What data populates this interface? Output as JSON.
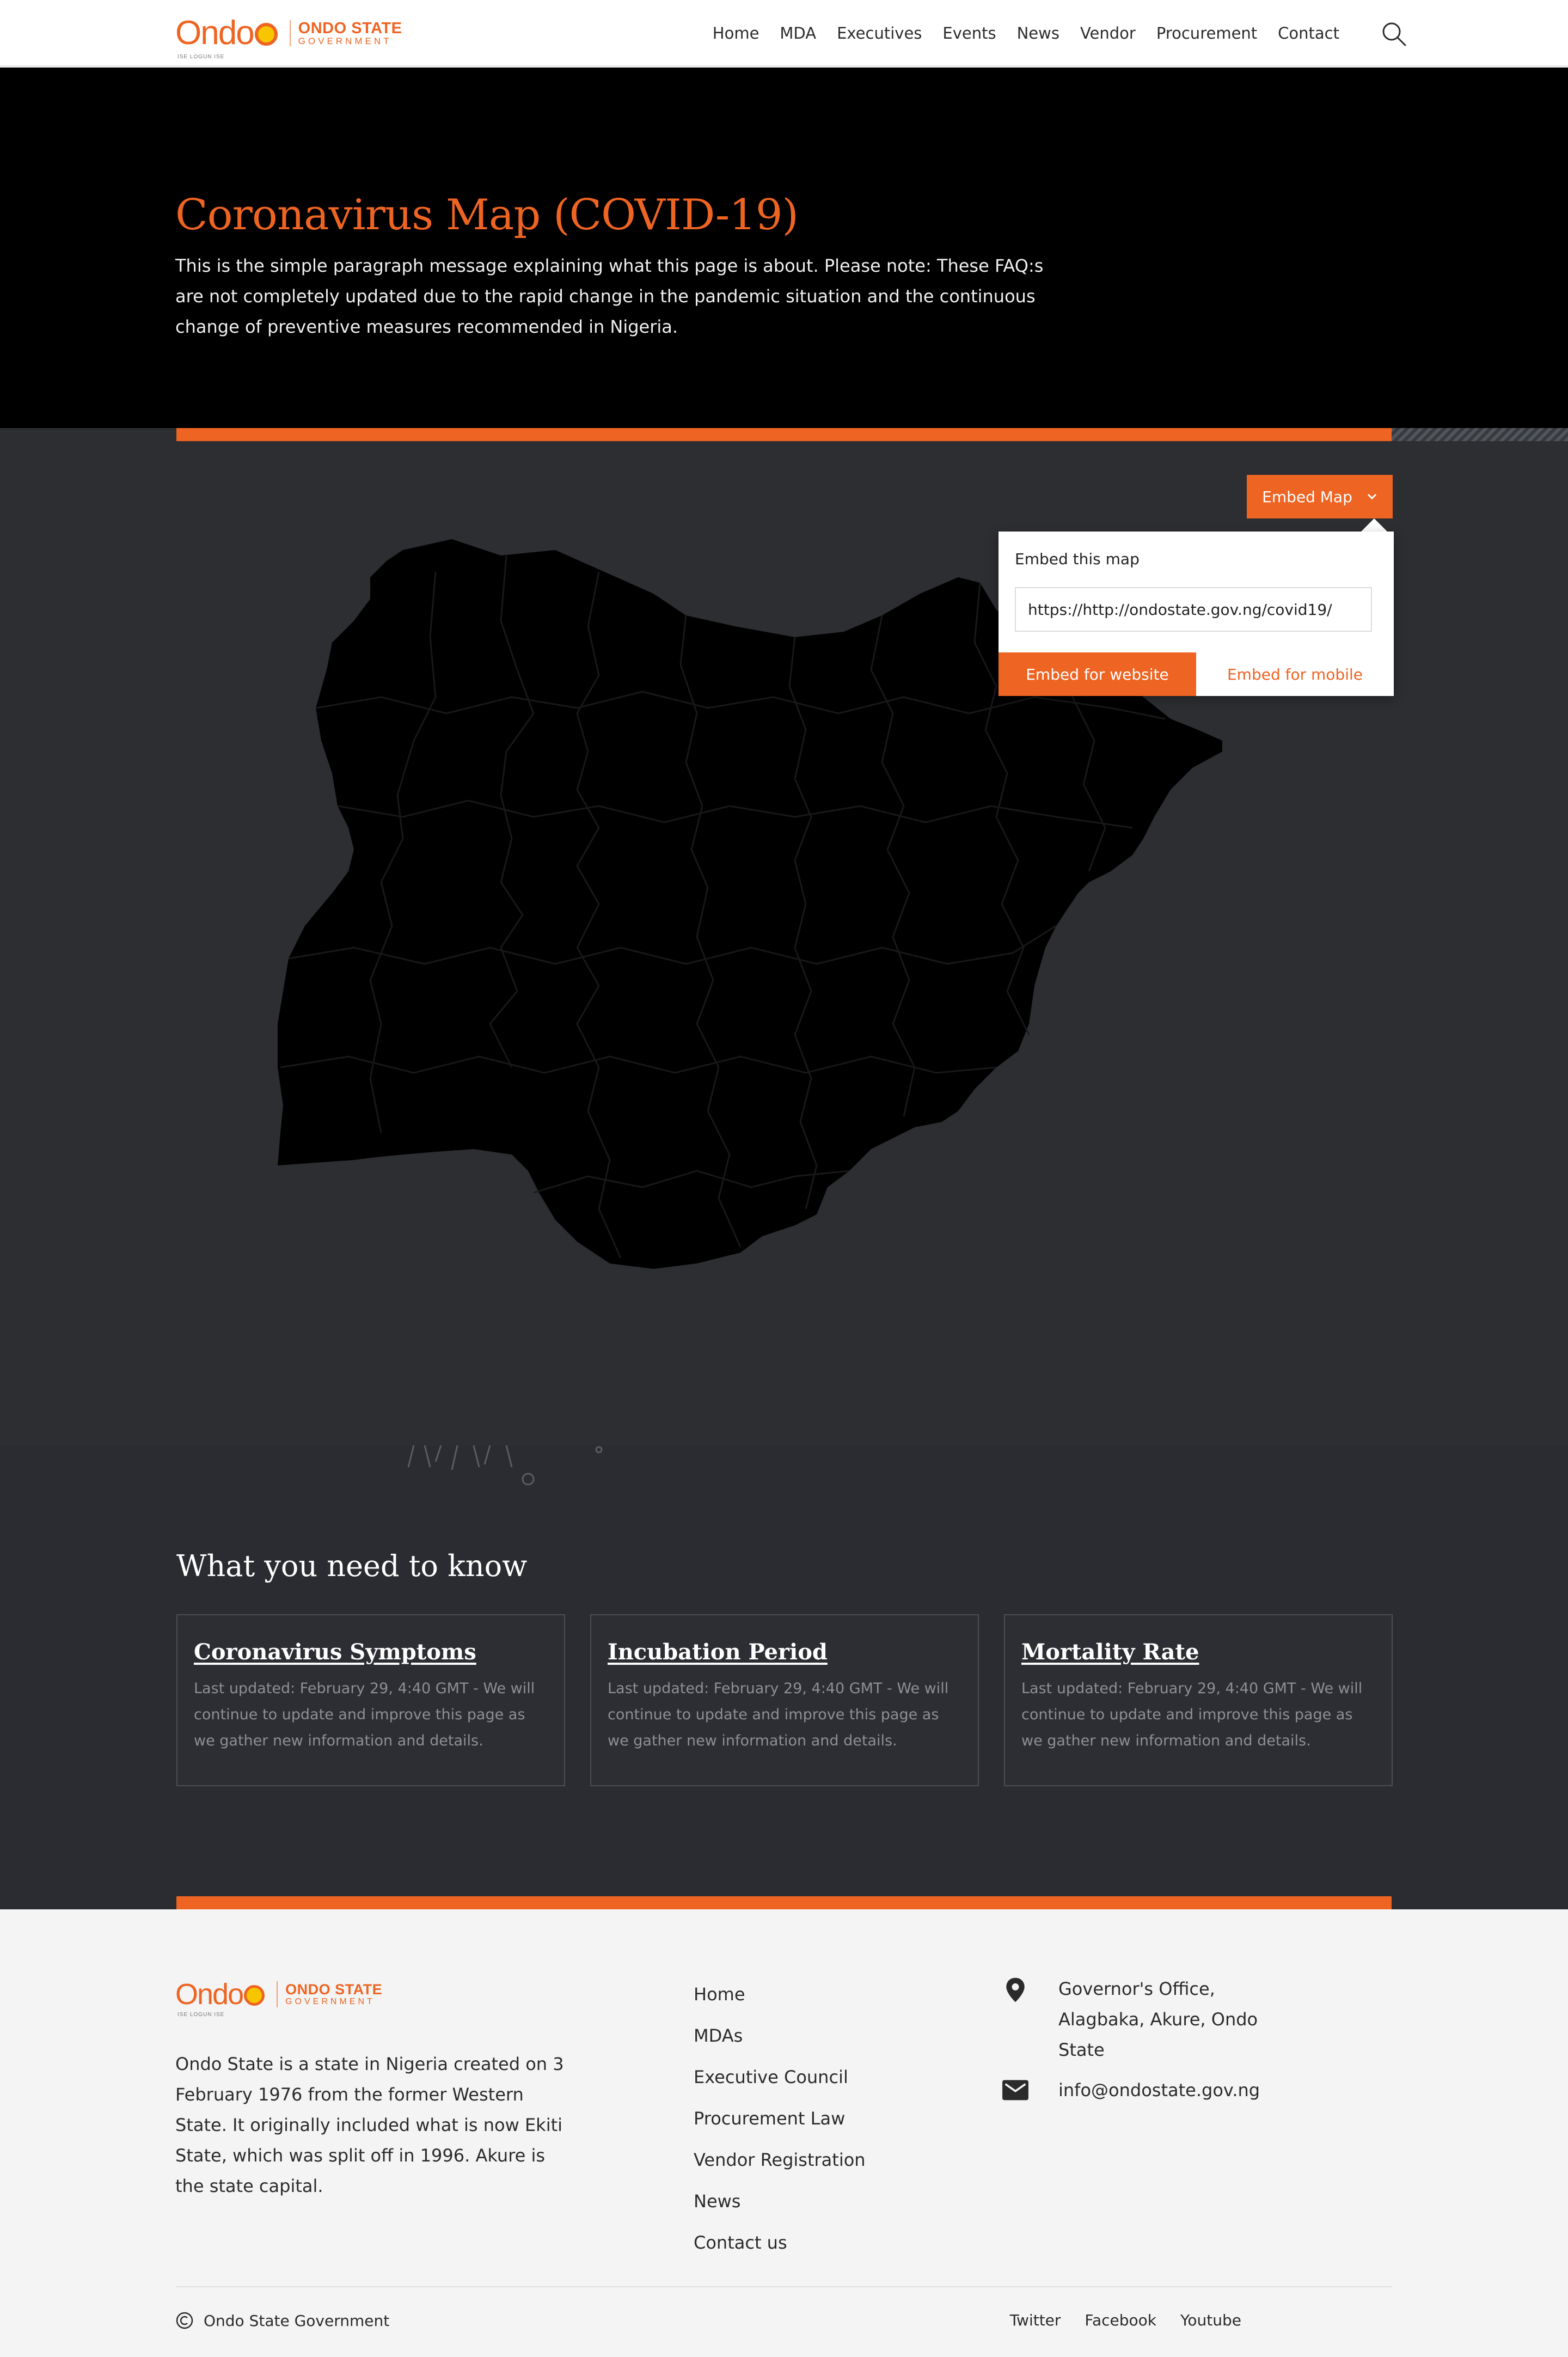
{
  "header": {
    "logo": {
      "wordmark": "Ondo",
      "tagline": "ISE LOGUN ISE",
      "state": "ONDO STATE",
      "government": "GOVERNMENT"
    },
    "nav": [
      "Home",
      "MDA",
      "Executives",
      "Events",
      "News",
      "Vendor",
      "Procurement",
      "Contact"
    ],
    "search_icon": "search-icon"
  },
  "hero": {
    "title": "Coronavirus Map (COVID-19)",
    "description": "This is the simple paragraph message explaining what this page is about. Please note: These FAQ:s are not completely updated due to the rapid change in the pandemic situation and the continuous change of preventive measures recommended in Nigeria."
  },
  "map": {
    "embed_button": "Embed Map",
    "embed_panel": {
      "title": "Embed this map",
      "url_value": "https://http://ondostate.gov.ng/covid19/",
      "tabs": [
        "Embed for website",
        "Embed for mobile"
      ]
    }
  },
  "know": {
    "title": "What you need to know",
    "cards": [
      {
        "title": "Coronavirus Symptoms",
        "text": "Last updated: February 29, 4:40 GMT - We will continue to update and improve this page as we gather new information and details."
      },
      {
        "title": "Incubation Period",
        "text": "Last updated: February 29, 4:40 GMT - We will continue to update and improve this page as we gather new information and details."
      },
      {
        "title": "Mortality Rate",
        "text": "Last updated: February 29, 4:40 GMT - We will continue to update and improve this page as we gather new information and details."
      }
    ]
  },
  "footer": {
    "logo": {
      "wordmark": "Ondo",
      "tagline": "ISE LOGUN ISE",
      "state": "ONDO STATE",
      "government": "GOVERNMENT"
    },
    "description": "Ondo State is a state in Nigeria created on 3 February 1976 from the former Western State. It originally included what is now Ekiti State, which was split off in 1996. Akure is the state capital.",
    "links": [
      "Home",
      "MDAs",
      "Executive Council",
      "Procurement Law",
      "Vendor Registration",
      "News",
      "Contact us"
    ],
    "address": "Governor's Office, Alagbaka, Akure, Ondo State",
    "email": "info@ondostate.gov.ng",
    "copyright": "Ondo State Government",
    "social": [
      "Twitter",
      "Facebook",
      "Youtube"
    ]
  },
  "colors": {
    "accent": "#ee6422",
    "hero_bg": "#000000",
    "section_bg": "#2d2e32",
    "footer_bg": "#f4f4f4"
  }
}
